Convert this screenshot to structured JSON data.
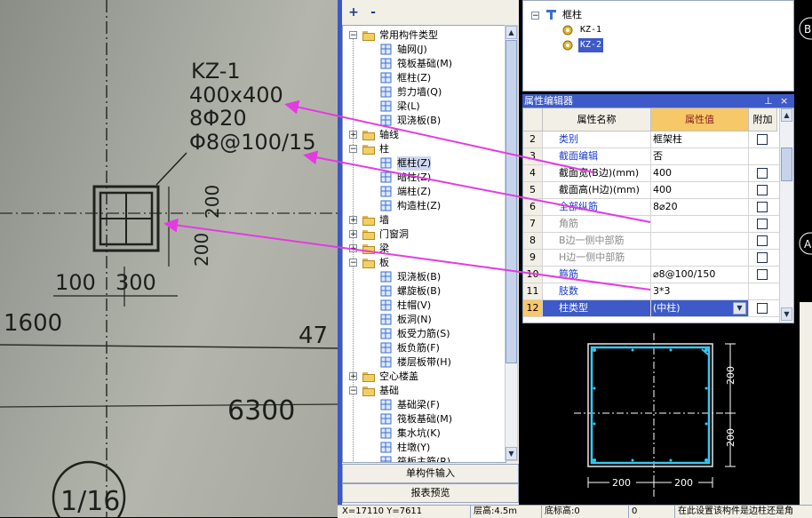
{
  "photo": {
    "texts": {
      "kz": "KZ-1",
      "size": "400x400",
      "rebar": "8Φ20",
      "stirrup": "Φ8@100/15",
      "dim200a": "200",
      "dim200b": "200",
      "d100": "100",
      "d300": "300",
      "d1600": "1600",
      "d47": "47",
      "d6300": "6300",
      "axis": "1/16"
    }
  },
  "toolbar": {
    "add_icon": "add-icon",
    "remove_icon": "remove-icon",
    "add_label": "+",
    "remove_label": "-"
  },
  "tree": {
    "items": [
      {
        "label": "常用构件类型",
        "level": 0,
        "expander": "−",
        "icon": "folder"
      },
      {
        "label": "轴网(J)",
        "level": 1,
        "icon": "grid-icon"
      },
      {
        "label": "筏板基础(M)",
        "level": 1,
        "icon": "raft-icon"
      },
      {
        "label": "框柱(Z)",
        "level": 1,
        "icon": "column-icon"
      },
      {
        "label": "剪力墙(Q)",
        "level": 1,
        "icon": "wall-icon"
      },
      {
        "label": "梁(L)",
        "level": 1,
        "icon": "beam-icon"
      },
      {
        "label": "现浇板(B)",
        "level": 1,
        "icon": "slab-icon"
      },
      {
        "label": "轴线",
        "level": 0,
        "expander": "+",
        "icon": "folder"
      },
      {
        "label": "柱",
        "level": 0,
        "expander": "−",
        "icon": "folder"
      },
      {
        "label": "框柱(Z)",
        "level": 1,
        "icon": "column-icon",
        "selected": true
      },
      {
        "label": "暗柱(Z)",
        "level": 1,
        "icon": "column-icon"
      },
      {
        "label": "端柱(Z)",
        "level": 1,
        "icon": "column-icon"
      },
      {
        "label": "构造柱(Z)",
        "level": 1,
        "icon": "gear-icon"
      },
      {
        "label": "墙",
        "level": 0,
        "expander": "+",
        "icon": "folder"
      },
      {
        "label": "门窗洞",
        "level": 0,
        "expander": "+",
        "icon": "folder"
      },
      {
        "label": "梁",
        "level": 0,
        "expander": "+",
        "icon": "folder"
      },
      {
        "label": "板",
        "level": 0,
        "expander": "−",
        "icon": "folder"
      },
      {
        "label": "现浇板(B)",
        "level": 1,
        "icon": "slab-icon"
      },
      {
        "label": "螺旋板(B)",
        "level": 1,
        "icon": "spiral-icon"
      },
      {
        "label": "柱帽(V)",
        "level": 1,
        "icon": "cap-icon"
      },
      {
        "label": "板洞(N)",
        "level": 1,
        "icon": "hole-icon"
      },
      {
        "label": "板受力筋(S)",
        "level": 1,
        "icon": "rebar-icon"
      },
      {
        "label": "板负筋(F)",
        "level": 1,
        "icon": "rebar-icon"
      },
      {
        "label": "楼层板带(H)",
        "level": 1,
        "icon": "band-icon"
      },
      {
        "label": "空心楼盖",
        "level": 0,
        "expander": "+",
        "icon": "folder"
      },
      {
        "label": "基础",
        "level": 0,
        "expander": "−",
        "icon": "folder"
      },
      {
        "label": "基础梁(F)",
        "level": 1,
        "icon": "beam-icon"
      },
      {
        "label": "筏板基础(M)",
        "level": 1,
        "icon": "raft-icon"
      },
      {
        "label": "集水坑(K)",
        "level": 1,
        "icon": "pit-icon"
      },
      {
        "label": "柱墩(Y)",
        "level": 1,
        "icon": "pier-icon"
      },
      {
        "label": "筏板主筋(R)",
        "level": 1,
        "icon": "rebar-icon"
      }
    ],
    "bottom_btn1": "单构件输入",
    "bottom_btn2": "报表预览"
  },
  "comp_tree": {
    "root": "框柱",
    "items": [
      {
        "label": "KZ-1",
        "selected": false
      },
      {
        "label": "KZ-2",
        "selected": true
      }
    ]
  },
  "prop_editor": {
    "title": "属性编辑器",
    "pin_label": "⊥",
    "close_label": "×",
    "col_name": "属性名称",
    "col_value": "属性值",
    "col_extra": "附加",
    "rows": [
      {
        "no": "2",
        "name": "类别",
        "value": "框架柱",
        "check": true,
        "blue": true
      },
      {
        "no": "3",
        "name": "截面编辑",
        "value": "否",
        "check": false,
        "blue": true
      },
      {
        "no": "4",
        "name": "截面宽(B边)(mm)",
        "value": "400",
        "check": true,
        "blue": false
      },
      {
        "no": "5",
        "name": "截面高(H边)(mm)",
        "value": "400",
        "check": true,
        "blue": false
      },
      {
        "no": "6",
        "name": "全部纵筋",
        "value": "8⌀20",
        "check": true,
        "blue": true
      },
      {
        "no": "7",
        "name": "角筋",
        "value": "",
        "check": true,
        "blue": false,
        "grey": true
      },
      {
        "no": "8",
        "name": "B边一侧中部筋",
        "value": "",
        "check": true,
        "blue": false,
        "grey": true
      },
      {
        "no": "9",
        "name": "H边一侧中部筋",
        "value": "",
        "check": true,
        "blue": false,
        "grey": true
      },
      {
        "no": "10",
        "name": "箍筋",
        "value": "⌀8@100/150",
        "check": true,
        "blue": true
      },
      {
        "no": "11",
        "name": "肢数",
        "value": "3*3",
        "check": false,
        "blue": true
      },
      {
        "no": "12",
        "name": "柱类型",
        "value": "(中柱)",
        "check": true,
        "blue": true,
        "selected": true
      }
    ]
  },
  "preview": {
    "dim_v1": "200",
    "dim_v2": "200",
    "dim_h1": "200",
    "dim_h2": "200"
  },
  "status": {
    "coords": "X=17110 Y=7611",
    "floor_height": "层高:4.5m",
    "bottom_elev": "底标高:0",
    "zero": "0",
    "hint": "在此设置该构件是边柱还是角"
  },
  "far_right": {
    "b_label": "B",
    "a_label": "A"
  }
}
